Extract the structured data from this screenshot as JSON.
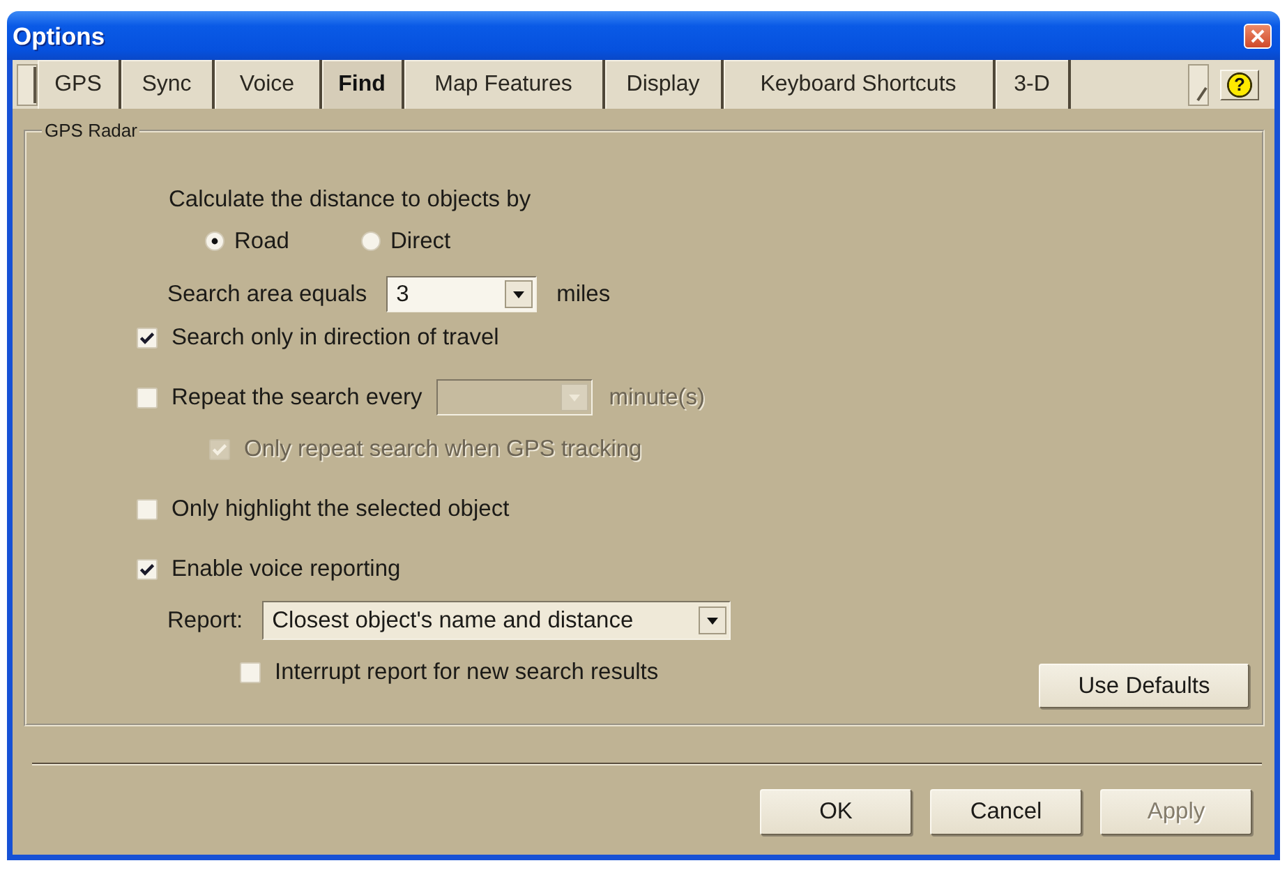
{
  "window": {
    "title": "Options",
    "help_label": "?"
  },
  "tabs": [
    {
      "label": "GPS",
      "selected": false
    },
    {
      "label": "Sync",
      "selected": false
    },
    {
      "label": "Voice",
      "selected": false
    },
    {
      "label": "Find",
      "selected": true
    },
    {
      "label": "Map Features",
      "selected": false
    },
    {
      "label": "Display",
      "selected": false
    },
    {
      "label": "Keyboard Shortcuts",
      "selected": false
    },
    {
      "label": "3-D",
      "selected": false
    }
  ],
  "group": {
    "title": "GPS Radar",
    "distance": {
      "label": "Calculate the distance to objects by",
      "options": [
        {
          "label": "Road",
          "selected": true
        },
        {
          "label": "Direct",
          "selected": false
        }
      ]
    },
    "search_area": {
      "label": "Search area equals",
      "value": "3",
      "unit": "miles"
    },
    "settings": [
      {
        "kind": "checkbox",
        "label": "Search only in direction of travel",
        "checked": true,
        "disabled": false
      },
      {
        "kind": "checkbox",
        "label": "Repeat the search every",
        "checked": false,
        "disabled": false,
        "dropdown": {
          "disabled": true
        },
        "unit": "minute(s)",
        "children": [
          {
            "kind": "checkbox",
            "label": "Only repeat search when GPS tracking",
            "checked": true,
            "disabled": true
          }
        ]
      },
      {
        "kind": "checkbox",
        "label": "Only highlight the selected object",
        "checked": false,
        "disabled": false
      },
      {
        "kind": "checkbox",
        "label": "Enable voice reporting",
        "checked": true,
        "disabled": false,
        "children": [
          {
            "kind": "dropdown",
            "label": "Report:",
            "value": "Closest object's name and distance",
            "children": [
              {
                "kind": "checkbox",
                "label": "Interrupt report for new search results",
                "checked": false,
                "disabled": false
              }
            ]
          }
        ]
      }
    ],
    "defaults_button": {
      "label": "Use Defaults"
    }
  },
  "buttons": [
    {
      "label": "OK",
      "disabled": false
    },
    {
      "label": "Cancel",
      "disabled": false
    },
    {
      "label": "Apply",
      "disabled": true
    }
  ]
}
